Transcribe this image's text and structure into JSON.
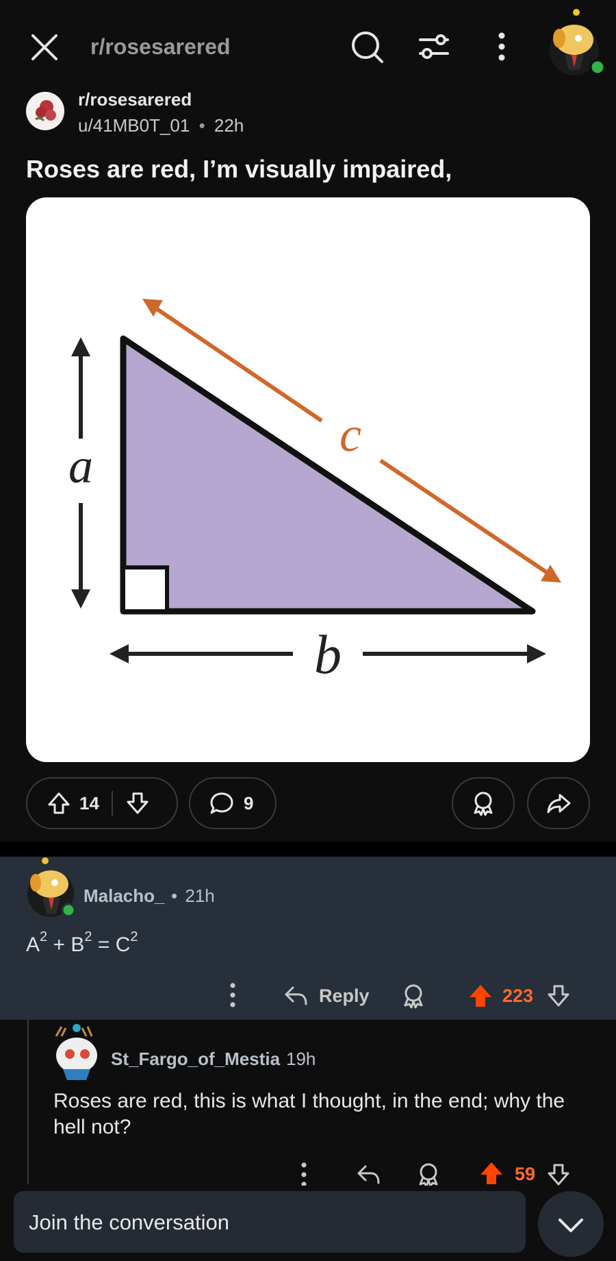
{
  "header": {
    "title": "r/rosesarered"
  },
  "post": {
    "subreddit": "r/rosesarered",
    "author": "u/41MB0T_01",
    "separator": "•",
    "age": "22h",
    "title": "Roses are red, I’m visually impaired,",
    "image_labels": {
      "a": "a",
      "b": "b",
      "c": "c"
    },
    "upvotes": "14",
    "comments": "9"
  },
  "comments": [
    {
      "author": "Malacho_",
      "separator": "•",
      "age": "21h",
      "body_parts": {
        "a": "A",
        "b": "B",
        "c": "C",
        "exp": "2",
        "plus": " + ",
        "eq": " = "
      },
      "reply_label": "Reply",
      "score": "223"
    },
    {
      "author": "St_Fargo_of_Mestia",
      "age": "19h",
      "body": "Roses are red, this is what I thought, in the end; why the hell not?",
      "score": "59"
    }
  ],
  "composer": {
    "placeholder": "Join the conversation"
  },
  "colors": {
    "accent_upvote": "#ff4500",
    "comment_bg": "#262f3a",
    "triangle_fill": "#b5a7cf",
    "hypotenuse_arrow": "#d0682a"
  }
}
